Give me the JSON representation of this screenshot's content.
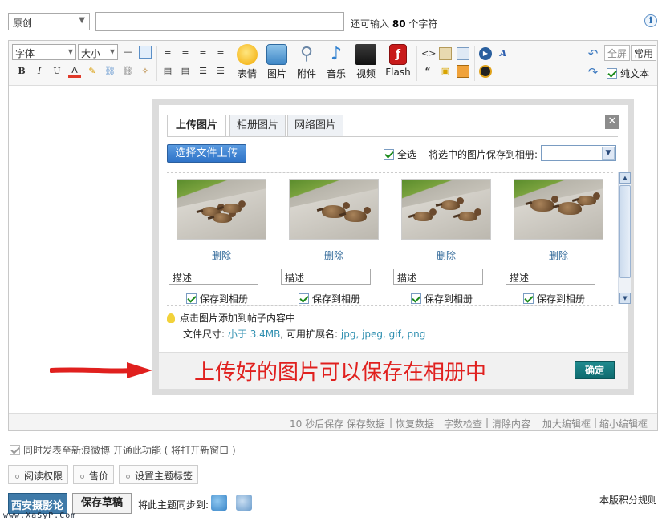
{
  "top": {
    "type_select": "原创",
    "title_value": "",
    "char_hint_prefix": "还可输入",
    "char_hint_count": "80",
    "char_hint_suffix": "个字符",
    "info_icon": "info-icon"
  },
  "toolbar": {
    "font_select": "字体",
    "size_select": "大小",
    "small_buttons": [
      "B",
      "I",
      "U",
      "A"
    ],
    "big_tools": [
      "表情",
      "图片",
      "附件",
      "音乐",
      "视频",
      "Flash"
    ],
    "fullscreen": "全屏",
    "common": "常用",
    "plain_text": "纯文本"
  },
  "status_bar": {
    "autosave": "10 秒后保存 保存数据",
    "restore": "恢复数据",
    "word_check": "字数检查",
    "clear": "清除内容",
    "enlarge": "加大编辑框",
    "shrink": "缩小编辑框"
  },
  "dialog": {
    "tabs": [
      "上传图片",
      "相册图片",
      "网络图片"
    ],
    "active_tab": "上传图片",
    "close_icon": "close-icon",
    "upload_button": "选择文件上传",
    "select_all": "全选",
    "save_to_album_label": "将选中的图片保存到相册:",
    "album_select_value": "",
    "photos": [
      {
        "delete": "删除",
        "desc_placeholder": "描述",
        "save_album": "保存到相册",
        "checked": true
      },
      {
        "delete": "删除",
        "desc_placeholder": "描述",
        "save_album": "保存到相册",
        "checked": true
      },
      {
        "delete": "删除",
        "desc_placeholder": "描述",
        "save_album": "保存到相册",
        "checked": true
      },
      {
        "delete": "删除",
        "desc_placeholder": "描述",
        "save_album": "保存到相册",
        "checked": true
      }
    ],
    "tip": "点击图片添加到帖子内容中",
    "file_size_label": "文件尺寸:",
    "file_size_value": "小于 3.4MB",
    "ext_label": ", 可用扩展名:",
    "ext_value": "jpg, jpeg, gif, png",
    "annotation": "上传好的图片可以保存在相册中",
    "ok_button": "确定"
  },
  "bottom": {
    "weibo_sync": "同时发表至新浪微博 开通此功能 ( 将打开新窗口 )",
    "options": [
      "阅读权限",
      "售价",
      "设置主题标签"
    ],
    "publish_button": "西安摄影论坛",
    "draft_button": "保存草稿",
    "sync_label": "将此主题同步到:",
    "rules_link": "本版积分规则",
    "watermark": "www.XaSyP.Com"
  },
  "colors": {
    "accent_blue": "#2f73c8",
    "ok_teal": "#0e6a6e",
    "annotation_red": "#e0201e",
    "link_blue": "#2a6496"
  }
}
